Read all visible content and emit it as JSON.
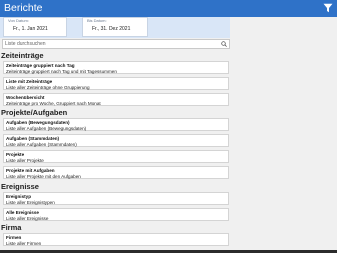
{
  "header": {
    "title": "Berichte",
    "filter_icon": "filter-icon"
  },
  "dates": {
    "from_label": "Von Datum:",
    "from_value": "Fr., 1. Jan 2021",
    "to_label": "Bis Datum:",
    "to_value": "Fr., 31. Dez 2021"
  },
  "search": {
    "placeholder": "Liste durchsuchen",
    "icon": "search-icon"
  },
  "sections": [
    {
      "title": "Zeiteinträge",
      "items": [
        {
          "title": "Zeiteinträge gruppiert nach Tag",
          "desc": "Zeiteinträge gruppiert nach Tag und mit Tagessummen"
        },
        {
          "title": "Liste mit Zeiteinträge",
          "desc": "Liste aller Zeiteinträge ohne Gruppierung"
        },
        {
          "title": "Wochenübersicht",
          "desc": "Zeiteinträge pro Woche, Gruppiert nach Monat"
        }
      ]
    },
    {
      "title": "Projekte/Aufgaben",
      "items": [
        {
          "title": "Aufgaben (Bewegungsdaten)",
          "desc": "Liste aller Aufgaben (Bewegungsdaten)"
        },
        {
          "title": "Aufgaben (Stammdaten)",
          "desc": "Liste aller Aufgaben (Stammdaten)"
        },
        {
          "title": "Projekte",
          "desc": "Liste aller Projekte"
        },
        {
          "title": "Projekte mit Aufgaben",
          "desc": "Liste aller Projekte mit den Aufgaben"
        }
      ]
    },
    {
      "title": "Ereignisse",
      "items": [
        {
          "title": "Ereignistyp",
          "desc": "Liste aller Ereignistypen"
        },
        {
          "title": "Alle Ereignisse",
          "desc": "Liste aller Ereignisse"
        }
      ]
    },
    {
      "title": "Firma",
      "items": [
        {
          "title": "Firmen",
          "desc": "Liste aller Firmen"
        }
      ]
    }
  ]
}
